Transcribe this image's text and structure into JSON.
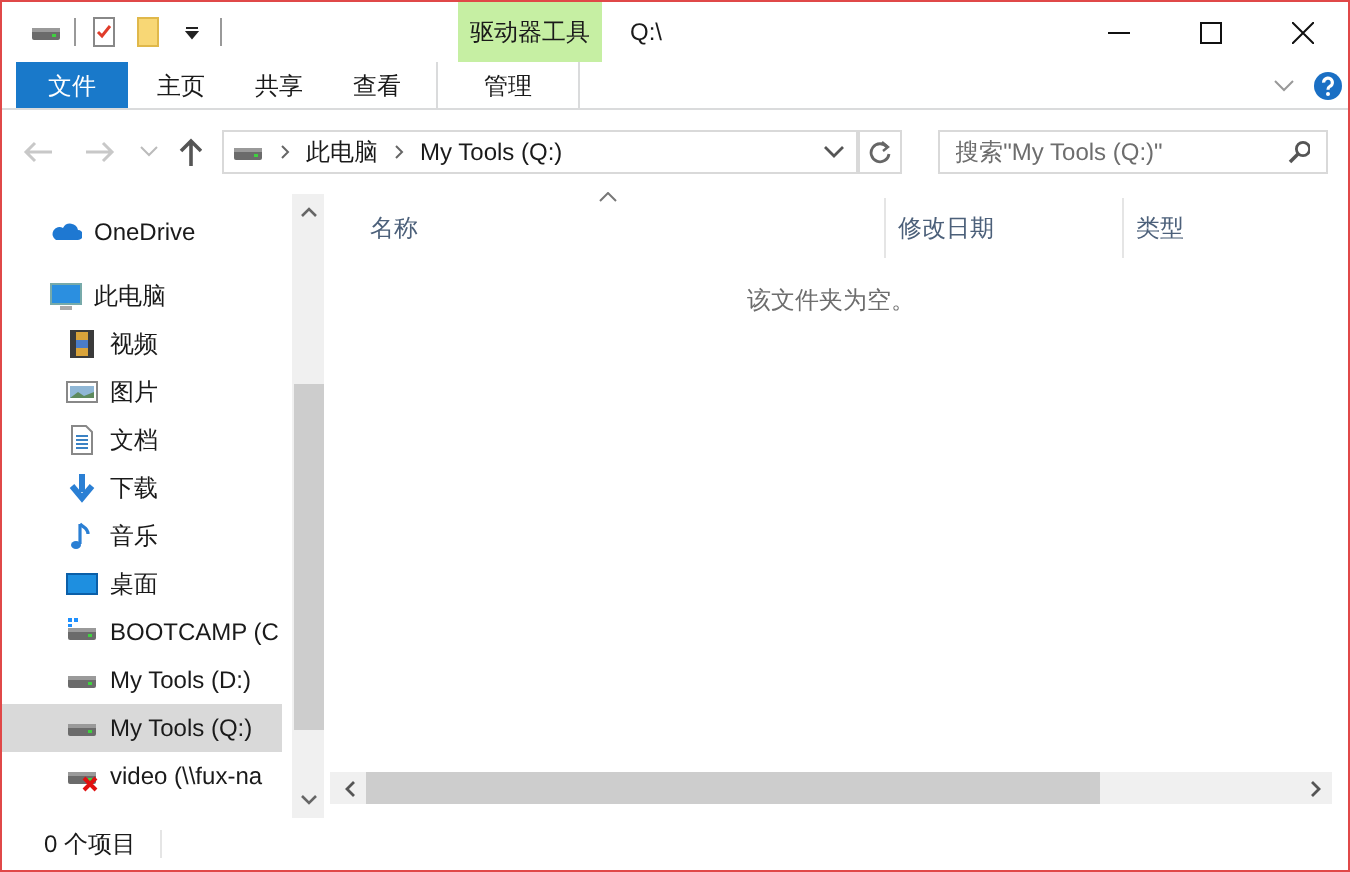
{
  "window": {
    "title": "Q:\\"
  },
  "quick_access_toolbar": {
    "items": [
      {
        "kind": "drive"
      },
      {
        "kind": "properties"
      },
      {
        "kind": "folder"
      },
      {
        "kind": "dropdown"
      }
    ]
  },
  "ribbon": {
    "context_label": "驱动器工具",
    "tabs": [
      {
        "label": "文件",
        "kind": "file"
      },
      {
        "label": "主页",
        "kind": "normal"
      },
      {
        "label": "共享",
        "kind": "normal"
      },
      {
        "label": "查看",
        "kind": "normal"
      },
      {
        "label": "管理",
        "kind": "context"
      }
    ]
  },
  "address_bar": {
    "back_disabled": true,
    "forward_disabled": true,
    "path": [
      "此电脑",
      "My Tools (Q:)"
    ]
  },
  "search": {
    "placeholder": "搜索\"My Tools (Q:)\""
  },
  "sidebar": {
    "items": [
      {
        "label": "OneDrive",
        "kind": "onedrive",
        "selected": false
      },
      {
        "label": "此电脑",
        "kind": "pc",
        "selected": false,
        "children": [
          {
            "label": "视频",
            "kind": "video",
            "selected": false
          },
          {
            "label": "图片",
            "kind": "pictures",
            "selected": false
          },
          {
            "label": "文档",
            "kind": "documents",
            "selected": false
          },
          {
            "label": "下载",
            "kind": "downloads",
            "selected": false
          },
          {
            "label": "音乐",
            "kind": "music",
            "selected": false
          },
          {
            "label": "桌面",
            "kind": "desktop",
            "selected": false
          },
          {
            "label": "BOOTCAMP (C",
            "kind": "windrive",
            "selected": false
          },
          {
            "label": "My Tools (D:)",
            "kind": "drive",
            "selected": false
          },
          {
            "label": "My Tools (Q:)",
            "kind": "drive",
            "selected": true
          },
          {
            "label": "video (\\\\fux-na",
            "kind": "netdrive",
            "selected": false
          }
        ]
      }
    ]
  },
  "file_list": {
    "columns": [
      {
        "label": "名称",
        "sorted": true
      },
      {
        "label": "修改日期",
        "sorted": false
      },
      {
        "label": "类型",
        "sorted": false
      }
    ],
    "empty_message": "该文件夹为空。"
  },
  "status_bar": {
    "item_count": "0 个项目"
  }
}
